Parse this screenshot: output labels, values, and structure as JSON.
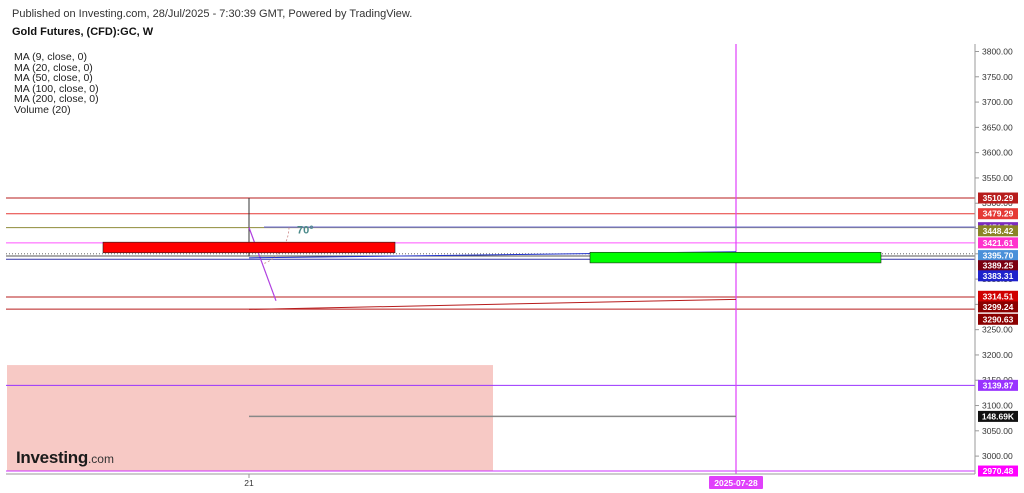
{
  "header": {
    "published": "Published on Investing.com, 28/Jul/2025 - 7:30:39 GMT, Powered by TradingView.",
    "symbol": "Gold Futures, (CFD):GC, W"
  },
  "legend": [
    "MA (9, close, 0)",
    "MA (20, close, 0)",
    "MA (50, close, 0)",
    "MA (100, close, 0)",
    "MA (200, close, 0)",
    "Volume (20)"
  ],
  "logo": {
    "name": "Investing",
    "suffix": ".com"
  },
  "chart_data": {
    "type": "candlestick",
    "title": "Gold Futures, (CFD):GC, W",
    "ylim": [
      2970,
      3820
    ],
    "y_ticks": [
      3000,
      3050,
      3100,
      3150,
      3200,
      3250,
      3300,
      3350,
      3400,
      3450,
      3500,
      3550,
      3600,
      3650,
      3700,
      3750,
      3800
    ],
    "y_tick_labels": [
      "3000.00",
      "3050.00",
      "3100.00",
      "3150.00",
      "3200.00",
      "3250.00",
      "3300.00",
      "3350.00",
      "3400.00",
      "3450.00",
      "3500.00",
      "3550.00",
      "3600.00",
      "3650.00",
      "3700.00",
      "3750.00",
      "3800.00"
    ],
    "x_labels": [
      "21",
      "2025-07-28"
    ],
    "candles": [
      {
        "name": "bearish-candle",
        "open": 3423,
        "close": 3402,
        "color": "#ff0000"
      },
      {
        "name": "bullish-candle",
        "open": 3382,
        "close": 3403,
        "color": "#00ff00"
      }
    ],
    "horizontal_levels": [
      {
        "value": 3510.29,
        "color": "#b71c1c"
      },
      {
        "value": 3479.29,
        "color": "#e53935"
      },
      {
        "value": 3451.7,
        "color": "#8e8c3a"
      },
      {
        "value": 3421.61,
        "color": "#ff55ff"
      },
      {
        "value": 3395.7,
        "color": "#555555"
      },
      {
        "value": 3389.25,
        "color": "#3333aa"
      },
      {
        "value": 3314.51,
        "color": "#b71c1c"
      },
      {
        "value": 3290.63,
        "color": "#b71c1c"
      },
      {
        "value": 3139.87,
        "color": "#9933ff"
      },
      {
        "value": 2970.48,
        "color": "#cc33ff"
      }
    ],
    "price_tags": [
      {
        "label": "3510.29",
        "value": 3510.29,
        "color": "#b71c1c"
      },
      {
        "label": "3479.29",
        "value": 3479.29,
        "color": "#e53935"
      },
      {
        "label": "3451.70",
        "value": 3451.7,
        "color": "#7b2cbf"
      },
      {
        "label": "3448.42",
        "value": 3445.5,
        "color": "#8b8526"
      },
      {
        "label": "3421.61",
        "value": 3421.61,
        "color": "#ff33cc"
      },
      {
        "label": "3395.70",
        "value": 3396.5,
        "color": "#4a90d9"
      },
      {
        "label": "3389.25",
        "value": 3376.5,
        "color": "#7a0010"
      },
      {
        "label": "3383.31",
        "value": 3356.5,
        "color": "#1e22cc"
      },
      {
        "label": "3314.51",
        "value": 3316.0,
        "color": "#d00000"
      },
      {
        "label": "3299.24",
        "value": 3295.0,
        "color": "#8b0000"
      },
      {
        "label": "3290.63",
        "value": 3270.5,
        "color": "#8b0000"
      },
      {
        "label": "3139.87",
        "value": 3139.87,
        "color": "#9933ff"
      },
      {
        "label": "148.69K",
        "value": 3078.5,
        "color": "#111111"
      },
      {
        "label": "2970.48",
        "value": 2970.48,
        "color": "#ff00ff"
      }
    ],
    "annotations": [
      {
        "text": "70°",
        "value": 3448,
        "color": "#4a8a8a"
      }
    ],
    "volume": {
      "label": "148.69K"
    },
    "grid": false
  }
}
